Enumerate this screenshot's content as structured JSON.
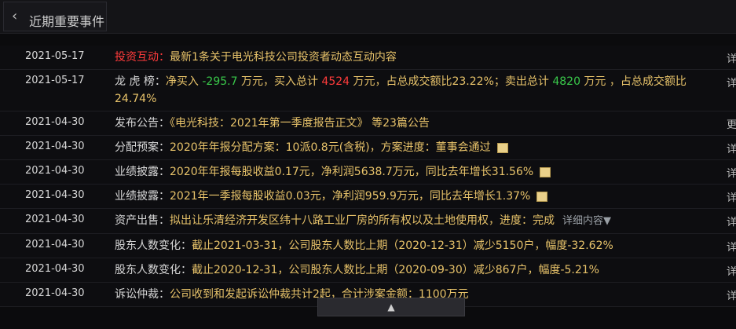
{
  "header": {
    "title": "近期重要事件",
    "collapse_icon": "chevron-left-icon"
  },
  "rows": [
    {
      "date": "2021-05-17",
      "category": "投资互动：",
      "category_red": true,
      "parts": [
        {
          "t": "最新1条关于电光科技公司投资者动态互动内容",
          "c": "y"
        }
      ],
      "edge": "详"
    },
    {
      "date": "2021-05-17",
      "category": "龙 虎 榜：",
      "parts": [
        {
          "t": "净买入 ",
          "c": "y"
        },
        {
          "t": "-295.7",
          "c": "green"
        },
        {
          "t": " 万元，",
          "c": "y"
        },
        {
          "t": "买入总计 ",
          "c": "y"
        },
        {
          "t": "4524",
          "c": "red"
        },
        {
          "t": " 万元，占总成交额比23.22%；",
          "c": "y"
        },
        {
          "t": "卖出总计 ",
          "c": "y"
        },
        {
          "t": "4820",
          "c": "green"
        },
        {
          "t": " 万元 ，占总成交额比",
          "c": "y"
        },
        {
          "t": "24.74%",
          "c": "y"
        }
      ],
      "edge": "详"
    },
    {
      "date": "2021-04-30",
      "category": "发布公告：",
      "parts": [
        {
          "t": "《电光科技：2021年第一季度报告正文》 等23篇公告",
          "c": "y"
        }
      ],
      "edge": "更"
    },
    {
      "date": "2021-04-30",
      "category": "分配预案：",
      "parts": [
        {
          "t": "2020年年报分配方案：10派0.8元(含税)，方案进度：董事会通过",
          "c": "y"
        }
      ],
      "doc": true,
      "edge": "详"
    },
    {
      "date": "2021-04-30",
      "category": "业绩披露：",
      "parts": [
        {
          "t": "2020年年报每股收益0.17元，净利润5638.7万元，同比去年增长31.56%",
          "c": "y"
        }
      ],
      "doc": true,
      "edge": "详"
    },
    {
      "date": "2021-04-30",
      "category": "业绩披露：",
      "parts": [
        {
          "t": "2021年一季报每股收益0.03元，净利润959.9万元，同比去年增长1.37%",
          "c": "y"
        }
      ],
      "doc": true,
      "edge": "详"
    },
    {
      "date": "2021-04-30",
      "category": "资产出售：",
      "parts": [
        {
          "t": "拟出让乐清经济开发区纬十八路工业厂房的所有权以及土地使用权，进度：完成",
          "c": "y"
        }
      ],
      "more": "详细内容▼",
      "edge": "详"
    },
    {
      "date": "2021-04-30",
      "category": "股东人数变化：",
      "parts": [
        {
          "t": "截止2021-03-31，公司股东人数比上期（2020-12-31）减少5150户，幅度-32.62%",
          "c": "y"
        }
      ],
      "edge": "详"
    },
    {
      "date": "2021-04-30",
      "category": "股东人数变化：",
      "parts": [
        {
          "t": "截止2020-12-31，公司股东人数比上期（2020-09-30）减少867户，幅度-5.21%",
          "c": "y"
        }
      ],
      "edge": "详"
    },
    {
      "date": "2021-04-30",
      "category": "诉讼仲裁：",
      "parts": [
        {
          "t": "公司收到和发起诉讼仲裁共计2起，合计涉案金额：1100万元",
          "c": "y"
        }
      ],
      "edge": "详"
    }
  ],
  "footer": {
    "collapse_label": "▲"
  }
}
